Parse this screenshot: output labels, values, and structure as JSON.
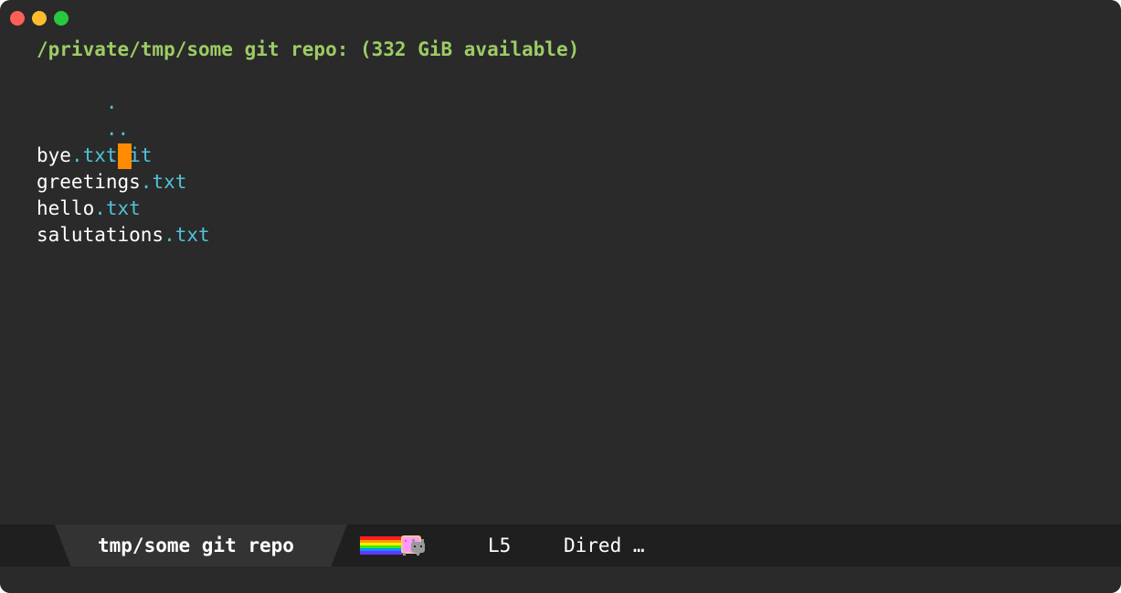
{
  "window": {
    "traffic_lights": [
      "close",
      "minimize",
      "maximize"
    ]
  },
  "dired": {
    "header": "/private/tmp/some git repo: (332 GiB available)",
    "entries": [
      {
        "kind": "dir",
        "name": "."
      },
      {
        "kind": "dir",
        "name": ".."
      },
      {
        "kind": "dir",
        "name": ".git"
      },
      {
        "kind": "file",
        "base": "bye",
        "ext": ".txt"
      },
      {
        "kind": "file",
        "base": "greetings",
        "ext": ".txt"
      },
      {
        "kind": "file",
        "base": "hello",
        "ext": ".txt"
      },
      {
        "kind": "file",
        "base": "salutations",
        "ext": ".txt"
      }
    ]
  },
  "modeline": {
    "buffer_name": "tmp/some git repo",
    "nyan_icon": "nyan-cat-icon",
    "line": "L5",
    "mode": "Dired …"
  },
  "colors": {
    "background": "#2a2a2a",
    "header": "#9ccc65",
    "dir": "#4fc3d9",
    "cursor": "#ff8c00",
    "modeline": "#1f1f1f",
    "modeline_tab": "#333333"
  }
}
